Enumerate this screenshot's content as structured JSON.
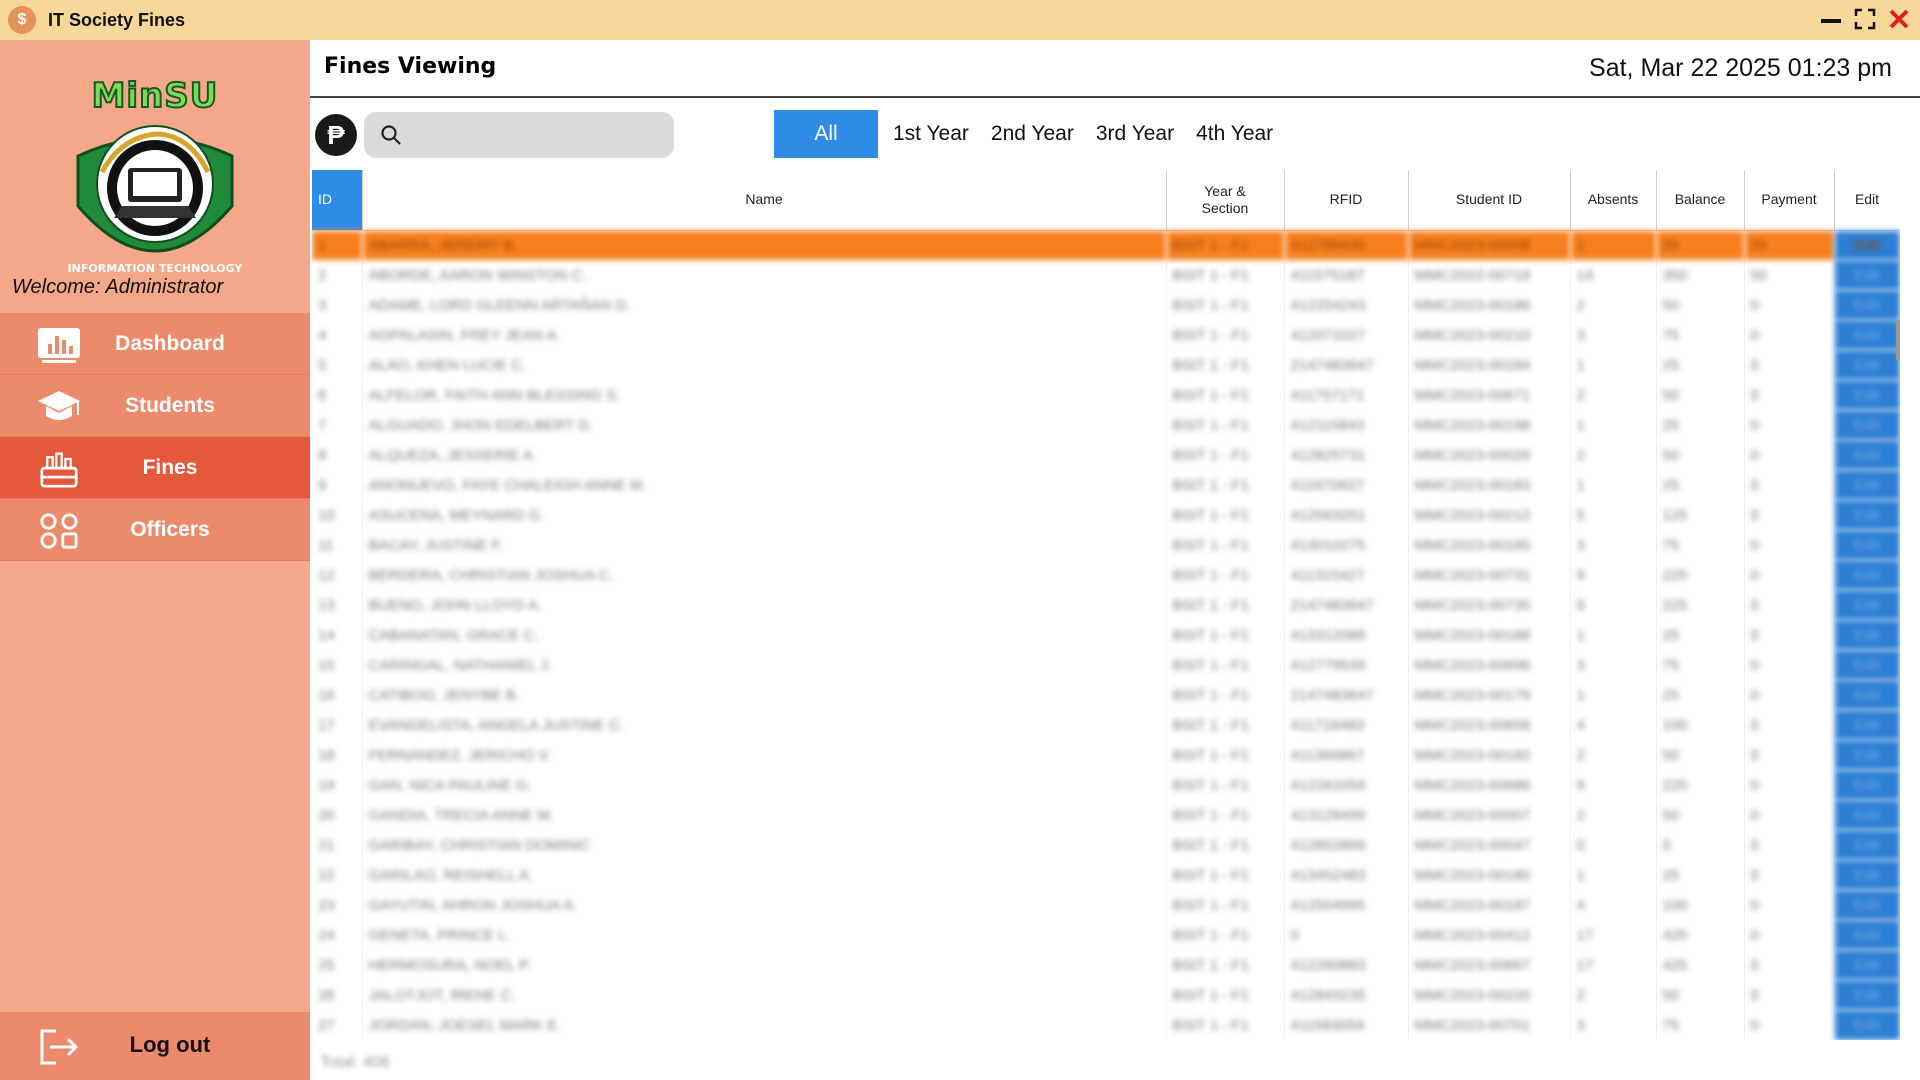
{
  "window": {
    "title": "IT Society Fines"
  },
  "sidebar": {
    "logo_text": "MinSU",
    "logo_ring_text": "INFORMATION TECHNOLOGY",
    "welcome": "Welcome: Administrator",
    "items": [
      {
        "label": "Dashboard",
        "icon": "dashboard-chart-icon"
      },
      {
        "label": "Students",
        "icon": "graduation-cap-icon"
      },
      {
        "label": "Fines",
        "icon": "fines-basket-icon",
        "active": true
      },
      {
        "label": "Officers",
        "icon": "officers-grid-icon"
      }
    ],
    "logout_label": "Log out"
  },
  "header": {
    "title": "Fines Viewing",
    "datetime": "Sat, Mar 22 2025 01:23 pm"
  },
  "toolbar": {
    "currency_symbol": "₱",
    "search_placeholder": "",
    "filters": [
      "All",
      "1st Year",
      "2nd Year",
      "3rd Year",
      "4th Year"
    ],
    "active_filter": "All"
  },
  "table": {
    "columns": [
      "ID",
      "Name",
      "Year & Section",
      "RFID",
      "Student ID",
      "Absents",
      "Balance",
      "Payment",
      "Edit"
    ],
    "rows": [
      [
        "1",
        "ABARRA, JEREMY B.",
        "BSIT 1 - F1",
        "412789430",
        "MMC2023-00008",
        "1",
        "25",
        "25",
        "Edit"
      ],
      [
        "2",
        "ABORDE, AARON WINSTON C.",
        "BSIT 1 - F1",
        "411575187",
        "MMC2022-00719",
        "14",
        "350",
        "50",
        "Edit"
      ],
      [
        "3",
        "ADAME, LORD GLEENN ARTAÑAN D.",
        "BSIT 1 - F1",
        "412254243",
        "MMC2023-00186",
        "2",
        "50",
        "0",
        "Edit"
      ],
      [
        "4",
        "AGPALASIN, FREY JEAN A.",
        "BSIT 1 - F1",
        "412071027",
        "MMC2023-00210",
        "3",
        "75",
        "0",
        "Edit"
      ],
      [
        "5",
        "ALAO, KHEN LUCIE C.",
        "BSIT 1 - F1",
        "2147483647",
        "MMC2023-00184",
        "1",
        "25",
        "0",
        "Edit"
      ],
      [
        "6",
        "ALFELOR, FAITH ANN BLESSING S.",
        "BSIT 1 - F1",
        "411757171",
        "MMC2023-00671",
        "2",
        "50",
        "0",
        "Edit"
      ],
      [
        "7",
        "ALGUADO, JHON EDELBERT D.",
        "BSIT 1 - F1",
        "412115843",
        "MMC2023-00198",
        "1",
        "25",
        "0",
        "Edit"
      ],
      [
        "8",
        "ALQUEZA, JESSERIE A.",
        "BSIT 1 - F1",
        "412825731",
        "MMC2023-00026",
        "2",
        "50",
        "0",
        "Edit"
      ],
      [
        "9",
        "ANONUEVO, FAYE CHALEIGH ANNE M.",
        "BSIT 1 - F1",
        "411670627",
        "MMC2023-00183",
        "1",
        "25",
        "0",
        "Edit"
      ],
      [
        "10",
        "ASUCENA, MEYNARD G.",
        "BSIT 1 - F1",
        "412563251",
        "MMC2023-00212",
        "5",
        "125",
        "0",
        "Edit"
      ],
      [
        "11",
        "BACAY, JUSTINE F.",
        "BSIT 1 - F1",
        "413010275",
        "MMC2023-00185",
        "3",
        "75",
        "0",
        "Edit"
      ],
      [
        "12",
        "BERDERA, CHRISTIAN JOSHUA C.",
        "BSIT 1 - F1",
        "411315427",
        "MMC2023-00731",
        "9",
        "225",
        "0",
        "Edit"
      ],
      [
        "13",
        "BUENO, JOHN LLOYD A.",
        "BSIT 1 - F1",
        "2147483647",
        "MMC2023-00735",
        "9",
        "225",
        "0",
        "Edit"
      ],
      [
        "14",
        "CABANATAN, GRACE C.",
        "BSIT 1 - F1",
        "413312089",
        "MMC2023-00188",
        "1",
        "25",
        "0",
        "Edit"
      ],
      [
        "15",
        "CARINGAL, NATHANIEL J.",
        "BSIT 1 - F1",
        "412779539",
        "MMC2023-00696",
        "3",
        "75",
        "0",
        "Edit"
      ],
      [
        "16",
        "CATIBOG, JENYBE B.",
        "BSIT 1 - F1",
        "2147483647",
        "MMC2023-00179",
        "1",
        "25",
        "0",
        "Edit"
      ],
      [
        "17",
        "EVANGELISTA, ANGELA JUSTINE C.",
        "BSIT 1 - F1",
        "411718483",
        "MMC2023-00658",
        "4",
        "100",
        "0",
        "Edit"
      ],
      [
        "18",
        "FERNANDEZ, JERICHO V.",
        "BSIT 1 - F1",
        "411366867",
        "MMC2023-00182",
        "2",
        "50",
        "0",
        "Edit"
      ],
      [
        "19",
        "GAN, NICA PAULINE G.",
        "BSIT 1 - F1",
        "412261059",
        "MMC2023-00686",
        "9",
        "225",
        "0",
        "Edit"
      ],
      [
        "20",
        "GANDIA, TRECIA ANNE M.",
        "BSIT 1 - F1",
        "413129499",
        "MMC2023-00007",
        "2",
        "50",
        "0",
        "Edit"
      ],
      [
        "21",
        "GARIBAY, CHRISTIAN DOMINIC",
        "BSIT 1 - F1",
        "412852899",
        "MMC2023-00047",
        "0",
        "0",
        "0",
        "Edit"
      ],
      [
        "22",
        "GARILAO, REISHELL A.",
        "BSIT 1 - F1",
        "413452483",
        "MMC2023-00180",
        "1",
        "25",
        "0",
        "Edit"
      ],
      [
        "23",
        "GAYUTIN, AHRON JOSHUA A.",
        "BSIT 1 - F1",
        "412504995",
        "MMC2023-00187",
        "4",
        "100",
        "0",
        "Edit"
      ],
      [
        "24",
        "GENETA, PRINCE L.",
        "BSIT 1 - F1",
        "0",
        "MMC2023-00412",
        "17",
        "425",
        "0",
        "Edit"
      ],
      [
        "25",
        "HERMOSURA, NOEL P.",
        "BSIT 1 - F1",
        "412260883",
        "MMC2023-00667",
        "17",
        "425",
        "0",
        "Edit"
      ],
      [
        "26",
        "JALOTJOT, IRENE C.",
        "BSIT 1 - F1",
        "412843235",
        "MMC2023-00220",
        "2",
        "50",
        "0",
        "Edit"
      ],
      [
        "27",
        "JORDAN, JOESEL MARK E.",
        "BSIT 1 - F1",
        "411583059",
        "MMC2023-00701",
        "3",
        "75",
        "0",
        "Edit"
      ]
    ],
    "total_label": "Total: 408"
  },
  "colors": {
    "titlebar": "#f7d79a",
    "sidebar": "#f5a889",
    "nav_item": "#ec8a6c",
    "nav_active": "#e4583b",
    "accent_blue": "#2e8be6",
    "selected_row": "#f7801e"
  }
}
